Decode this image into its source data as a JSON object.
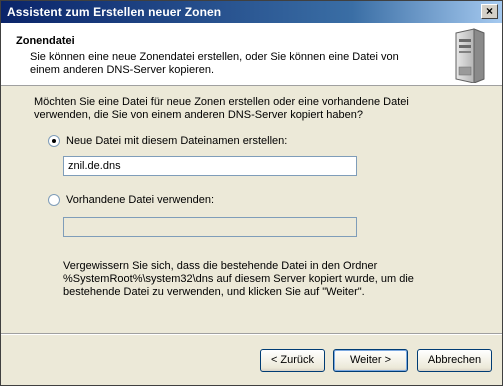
{
  "window": {
    "title": "Assistent zum Erstellen neuer Zonen",
    "close_glyph": "×"
  },
  "header": {
    "title": "Zonendatei",
    "description": "Sie können eine neue Zonendatei erstellen, oder Sie können eine Datei von einem anderen DNS-Server kopieren.",
    "icon": "server-icon"
  },
  "main": {
    "question": "Möchten Sie eine Datei für neue Zonen erstellen oder eine vorhandene Datei verwenden, die Sie von einem anderen DNS-Server kopiert haben?",
    "option_new": {
      "label": "Neue Datei mit diesem Dateinamen erstellen:",
      "selected": true
    },
    "filename_value": "znil.de.dns",
    "option_existing": {
      "label": "Vorhandene Datei verwenden:",
      "selected": false
    },
    "existing_value": "",
    "note": "Vergewissern Sie sich, dass die bestehende Datei in den Ordner %SystemRoot%\\system32\\dns auf diesem Server kopiert wurde, um die bestehende Datei zu verwenden, und klicken Sie auf \"Weiter\"."
  },
  "buttons": {
    "back": "< Zurück",
    "next": "Weiter >",
    "cancel": "Abbrechen"
  }
}
